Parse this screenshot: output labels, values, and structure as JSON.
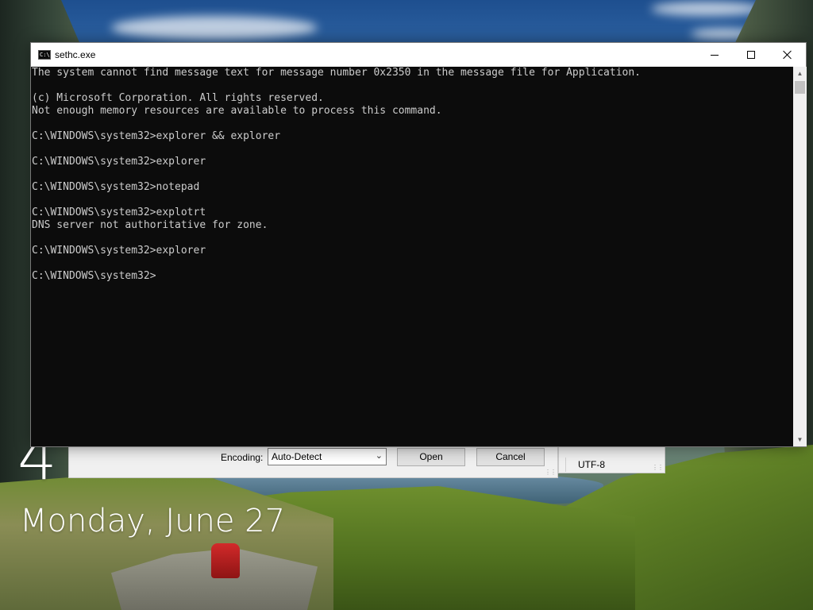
{
  "lock_screen": {
    "time": "4",
    "date": "Monday, June 27"
  },
  "background_dialog": {
    "encoding_label": "Encoding:",
    "encoding_value": "Auto-Detect",
    "open_button": "Open",
    "cancel_button": "Cancel",
    "status_encoding": "UTF-8"
  },
  "console": {
    "title": "sethc.exe",
    "icon_text": "C:\\",
    "lines": [
      "The system cannot find message text for message number 0x2350 in the message file for Application.",
      "",
      "(c) Microsoft Corporation. All rights reserved.",
      "Not enough memory resources are available to process this command.",
      "",
      "C:\\WINDOWS\\system32>explorer && explorer",
      "",
      "C:\\WINDOWS\\system32>explorer",
      "",
      "C:\\WINDOWS\\system32>notepad",
      "",
      "C:\\WINDOWS\\system32>explotrt",
      "DNS server not authoritative for zone.",
      "",
      "C:\\WINDOWS\\system32>explorer",
      "",
      "C:\\WINDOWS\\system32>"
    ],
    "colors": {
      "background": "#0c0c0c",
      "text": "#cccccc"
    }
  }
}
